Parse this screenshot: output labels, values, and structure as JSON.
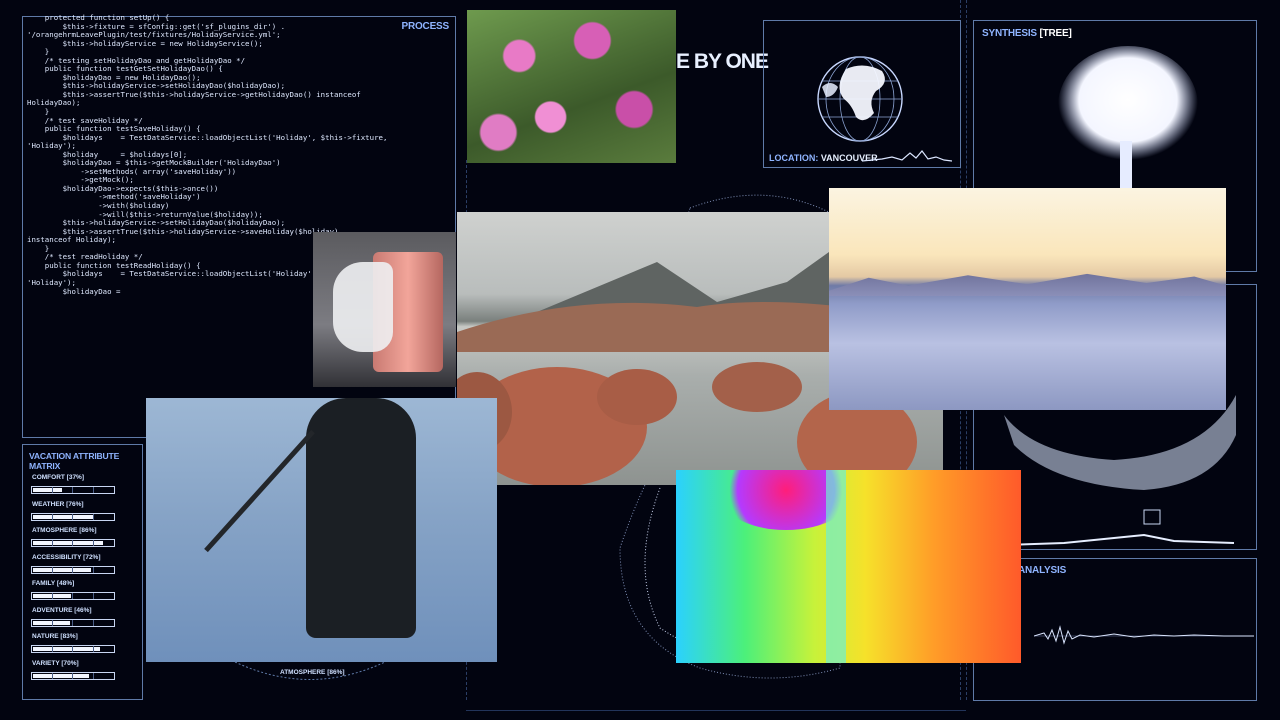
{
  "process_panel": {
    "label": "PROCESS",
    "code_lines": [
      "    protected function setUp() {",
      "        $this->fixture = sfConfig::get('sf_plugins_dir') .",
      "'/orangehrmLeavePlugin/test/fixtures/HolidayService.yml';",
      "        $this->holidayService = new HolidayService();",
      "    }",
      "",
      "    /* testing setHolidayDao and getHolidayDao */",
      "",
      "    public function testGetSetHolidayDao() {",
      "",
      "        $holidayDao = new HolidayDao();",
      "        $this->holidayService->setHolidayDao($holidayDao);",
      "",
      "        $this->assertTrue($this->holidayService->getHolidayDao() instanceof",
      "HolidayDao);",
      "",
      "    }",
      "",
      "    /* test saveHoliday */",
      "",
      "    public function testSaveHoliday() {",
      "",
      "        $holidays    = TestDataService::loadObjectList('Holiday', $this->fixture,",
      "'Holiday');",
      "        $holiday     = $holidays[0];",
      "",
      "        $holidayDao = $this->getMockBuilder('HolidayDao')",
      "            ->setMethods( array('saveHoliday'))",
      "            ->getMock();",
      "        $holidayDao->expects($this->once())",
      "                ->method('saveHoliday')",
      "                ->with($holiday)",
      "                ->will($this->returnValue($holiday));",
      "",
      "        $this->holidayService->setHolidayDao($holidayDao);",
      "",
      "        $this->assertTrue($this->holidayService->saveHoliday($holiday)",
      "instanceof Holiday);",
      "",
      "    }",
      "",
      "    /* test readHoliday */",
      "",
      "    public function testReadHoliday() {",
      "",
      "        $holidays    = TestDataService::loadObjectList('Holiday', $this->fixture,",
      "'Holiday');",
      "",
      "        $holidayDao = "
    ]
  },
  "headline": "E BY ONE",
  "location": {
    "label": "LOCATION:",
    "value": "VANCOUVER"
  },
  "synthesis": {
    "label": "SYNTHESIS",
    "tag": "[TREE]"
  },
  "analysis": {
    "label": "ANALYSIS"
  },
  "attribute_matrix": {
    "title": "VACATION ATTRIBUTE MATRIX",
    "items": [
      {
        "label": "COMFORT [37%]",
        "percent": 37
      },
      {
        "label": "WEATHER [76%]",
        "percent": 76
      },
      {
        "label": "ATMOSPHERE [86%]",
        "percent": 86
      },
      {
        "label": "ACCESSIBILITY [72%]",
        "percent": 72
      },
      {
        "label": "FAMILY [48%]",
        "percent": 48
      },
      {
        "label": "ADVENTURE [46%]",
        "percent": 46
      },
      {
        "label": "NATURE [83%]",
        "percent": 83
      },
      {
        "label": "VARIETY [70%]",
        "percent": 70
      }
    ]
  },
  "atmosphere_dial": {
    "label": "ATMOSPHERE [86%]"
  },
  "colors": {
    "panel_border": "#5f7aa8",
    "label_blue": "#8fb4ff",
    "background": "#020410"
  }
}
